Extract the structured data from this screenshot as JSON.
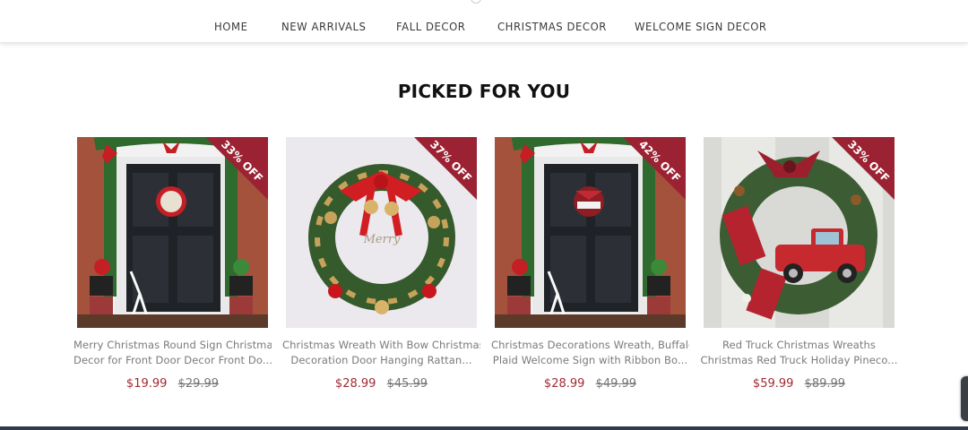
{
  "nav": {
    "items": [
      {
        "label": "HOME"
      },
      {
        "label": "NEW ARRIVALS"
      },
      {
        "label": "FALL DECOR"
      },
      {
        "label": "CHRISTMAS DECOR"
      },
      {
        "label": "WELCOME SIGN DECOR"
      }
    ]
  },
  "section": {
    "title": "PICKED FOR YOU"
  },
  "products": [
    {
      "discount": "33% OFF",
      "title_line1": "Merry Christmas Round Sign Christmas",
      "title_line2": "Decor for Front Door Decor Front Do...",
      "price": "$19.99",
      "compare_price": "$29.99",
      "image": "front-door-christmas-sign"
    },
    {
      "discount": "37% OFF",
      "title_line1": "Christmas Wreath With Bow Christmas",
      "title_line2": "Decoration Door Hanging Rattan...",
      "price": "$28.99",
      "compare_price": "$45.99",
      "image": "wreath-with-bow"
    },
    {
      "discount": "42% OFF",
      "title_line1": "Christmas Decorations Wreath, Buffalo",
      "title_line2": "Plaid Welcome Sign with Ribbon Bo...",
      "price": "$28.99",
      "compare_price": "$49.99",
      "image": "front-door-welcome-sign"
    },
    {
      "discount": "33% OFF",
      "title_line1": "Red Truck Christmas Wreaths",
      "title_line2": "Christmas Red Truck Holiday Pineco...",
      "price": "$59.99",
      "compare_price": "$89.99",
      "image": "red-truck-wreath"
    }
  ],
  "colors": {
    "sale_badge": "#9b2232",
    "price": "#a02b34",
    "nav_text": "#3a3a3a"
  }
}
